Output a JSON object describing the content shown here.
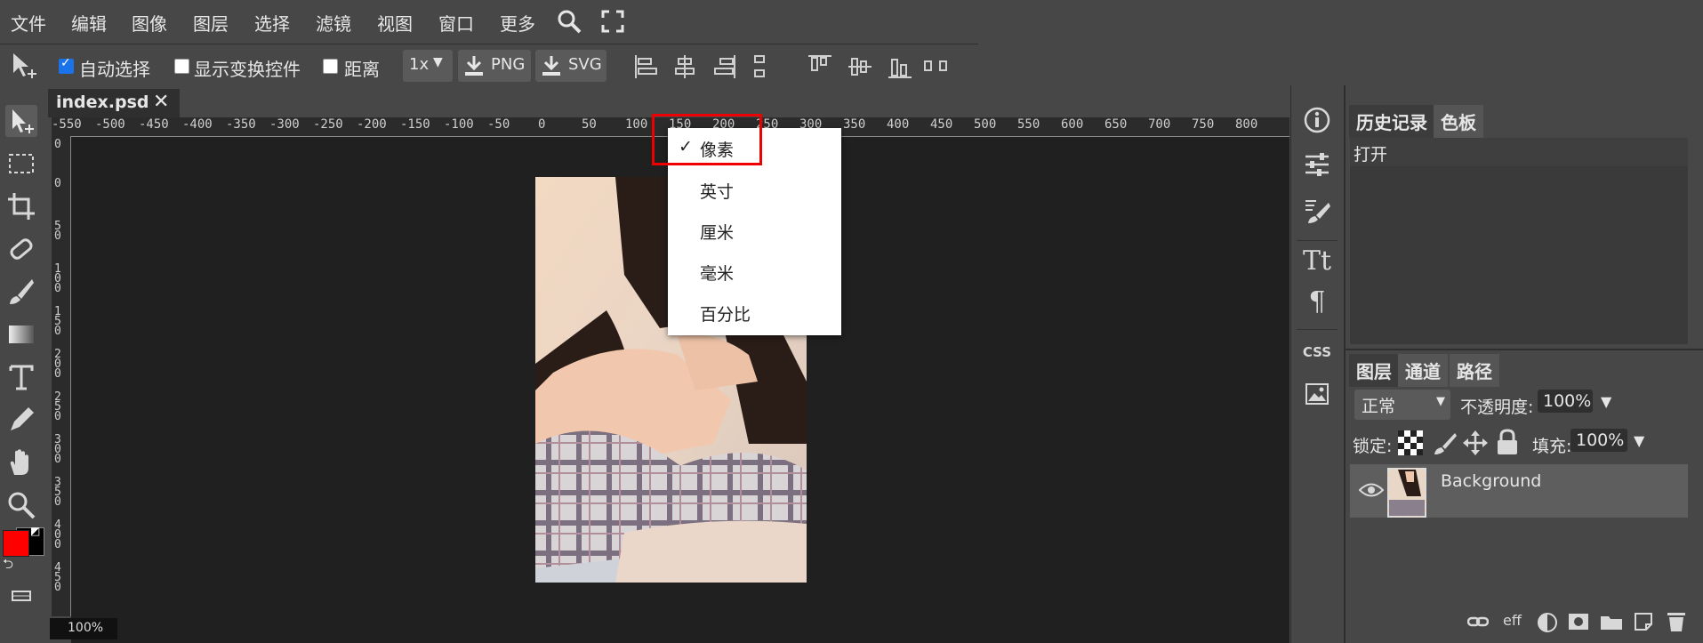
{
  "menu": [
    "文件",
    "编辑",
    "图像",
    "图层",
    "选择",
    "滤镜",
    "视图",
    "窗口",
    "更多"
  ],
  "options": {
    "auto_select_label": "自动选择",
    "auto_select_checked": true,
    "show_transform_label": "显示变换控件",
    "distance_label": "距离",
    "scale_value": "1x",
    "png_label": "PNG",
    "svg_label": "SVG"
  },
  "panel_toggles": {
    "left": "> <",
    "mid": "< >",
    "right": "> <"
  },
  "document": {
    "tab_title": "index.psd",
    "zoom": "100%"
  },
  "ruler": {
    "h_ticks": [
      "-550",
      "-500",
      "-450",
      "-400",
      "-350",
      "-300",
      "-250",
      "-200",
      "-150",
      "-100",
      "-50",
      "0",
      "50",
      "100",
      "150",
      "200",
      "250",
      "300",
      "350",
      "400",
      "450",
      "500",
      "550",
      "600",
      "650",
      "700",
      "750",
      "800"
    ],
    "v_ticks": [
      "0",
      "0",
      "5 0",
      "1 0 0",
      "1 5 0",
      "2 0 0",
      "2 5 0",
      "3 0 0",
      "3 5 0",
      "4 0 0",
      "4 5 0"
    ]
  },
  "units_menu": {
    "items": [
      "像素",
      "英寸",
      "厘米",
      "毫米",
      "百分比"
    ],
    "selected_index": 0,
    "check_mark": "✓"
  },
  "colors": {
    "foreground": "#ff0000",
    "background": "#000000",
    "highlight": "#e00000"
  },
  "history_panel": {
    "tabs": [
      "历史记录",
      "色板"
    ],
    "items": [
      "打开"
    ]
  },
  "layers_panel": {
    "tabs": [
      "图层",
      "通道",
      "路径"
    ],
    "blend_mode": "正常",
    "opacity_label": "不透明度:",
    "opacity_value": "100%",
    "lock_label": "锁定:",
    "fill_label": "填充:",
    "fill_value": "100%",
    "layers": [
      {
        "name": "Background",
        "visible": true
      }
    ],
    "fx_label": "eff"
  },
  "strip_css_label": "CSS"
}
